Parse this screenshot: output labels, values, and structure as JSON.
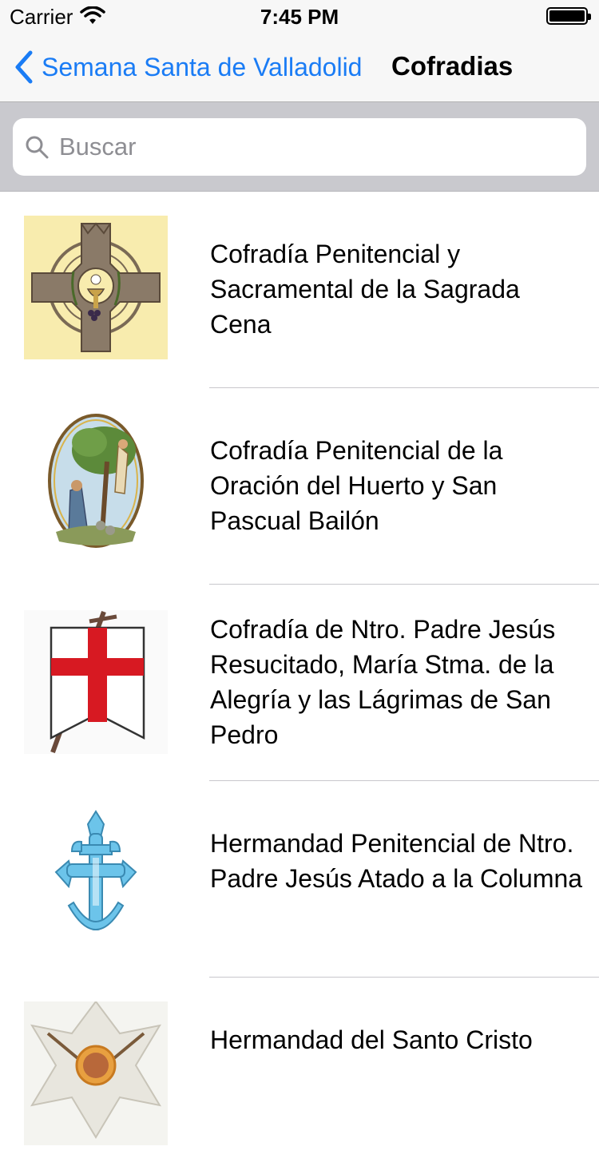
{
  "status_bar": {
    "carrier": "Carrier",
    "time": "7:45 PM"
  },
  "nav": {
    "back_label": "Semana Santa de Valladolid",
    "title": "Cofradias",
    "accent_color": "#1a7cf5"
  },
  "search": {
    "placeholder": "Buscar",
    "value": ""
  },
  "list": {
    "items": [
      {
        "name": "Cofradía Penitencial y Sacramental de la Sagrada Cena",
        "icon": "sagrada-cena-emblem"
      },
      {
        "name": "Cofradía Penitencial de la Oración del Huerto y San Pascual Bailón",
        "icon": "oracion-huerto-emblem"
      },
      {
        "name": "Cofradía de Ntro. Padre Jesús Resucitado, María Stma. de la Alegría y las Lágrimas de San Pedro",
        "icon": "resucitado-banner-emblem"
      },
      {
        "name": "Hermandad Penitencial de Ntro. Padre Jesús Atado a la Columna",
        "icon": "atado-columna-cross-emblem"
      },
      {
        "name": "Hermandad del Santo Cristo",
        "icon": "santo-cristo-emblem"
      }
    ]
  }
}
